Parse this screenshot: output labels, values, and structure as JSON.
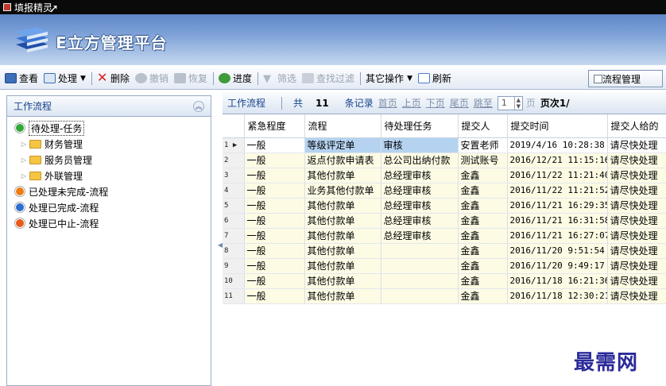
{
  "window": {
    "title": "填报精灵"
  },
  "banner": {
    "brand": "E立方管理平台"
  },
  "toolbar": {
    "view": "查看",
    "process": "处理",
    "delete": "删除",
    "revoke": "撤销",
    "restore": "恢复",
    "progress": "进度",
    "filter": "筛选",
    "search_filter": "查找过滤",
    "other_ops": "其它操作",
    "refresh": "刷新",
    "flow_mgmt": "流程管理"
  },
  "left": {
    "header": "工作流程",
    "tree": [
      {
        "label": "待处理-任务",
        "icon": "green",
        "selected": true
      },
      {
        "label": "财务管理",
        "child": true
      },
      {
        "label": "服务员管理",
        "child": true
      },
      {
        "label": "外联管理",
        "child": true
      },
      {
        "label": "已处理未完成-流程",
        "icon": "orange"
      },
      {
        "label": "处理已完成-流程",
        "icon": "blue"
      },
      {
        "label": "处理已中止-流程",
        "icon": "orangered"
      }
    ]
  },
  "pager": {
    "flow_label": "工作流程",
    "total_prefix": "共",
    "total": "11",
    "total_suffix": "条记录",
    "first": "首页",
    "prev": "上页",
    "next": "下页",
    "last": "尾页",
    "jump": "跳至",
    "page_value": "1",
    "page_unit": "页",
    "page_info": "页次1/"
  },
  "grid": {
    "columns": [
      "紧急程度",
      "流程",
      "待处理任务",
      "提交人",
      "提交时间",
      "提交人给的"
    ],
    "rows": [
      [
        "1",
        "一般",
        "等级评定单",
        "审核",
        "安置老师",
        "2019/4/16 10:28:38",
        "请尽快处理"
      ],
      [
        "2",
        "一般",
        "返点付款申请表",
        "总公司出纳付款",
        "测试账号",
        "2016/12/21 11:15:16",
        "请尽快处理"
      ],
      [
        "3",
        "一般",
        "其他付款单",
        "总经理审核",
        "金鑫",
        "2016/11/22 11:21:40",
        "请尽快处理"
      ],
      [
        "4",
        "一般",
        "业务其他付款单",
        "总经理审核",
        "金鑫",
        "2016/11/22 11:21:52",
        "请尽快处理"
      ],
      [
        "5",
        "一般",
        "其他付款单",
        "总经理审核",
        "金鑫",
        "2016/11/21 16:29:35",
        "请尽快处理"
      ],
      [
        "6",
        "一般",
        "其他付款单",
        "总经理审核",
        "金鑫",
        "2016/11/21 16:31:58",
        "请尽快处理"
      ],
      [
        "7",
        "一般",
        "其他付款单",
        "总经理审核",
        "金鑫",
        "2016/11/21 16:27:07",
        "请尽快处理"
      ],
      [
        "8",
        "一般",
        "其他付款单",
        "",
        "金鑫",
        "2016/11/20 9:51:54",
        "请尽快处理"
      ],
      [
        "9",
        "一般",
        "其他付款单",
        "",
        "金鑫",
        "2016/11/20 9:49:17",
        "请尽快处理"
      ],
      [
        "10",
        "一般",
        "其他付款单",
        "",
        "金鑫",
        "2016/11/18 16:21:36",
        "请尽快处理"
      ],
      [
        "11",
        "一般",
        "其他付款单",
        "",
        "金鑫",
        "2016/11/18 12:30:21",
        "请尽快处理"
      ]
    ]
  },
  "watermark": "最需网"
}
